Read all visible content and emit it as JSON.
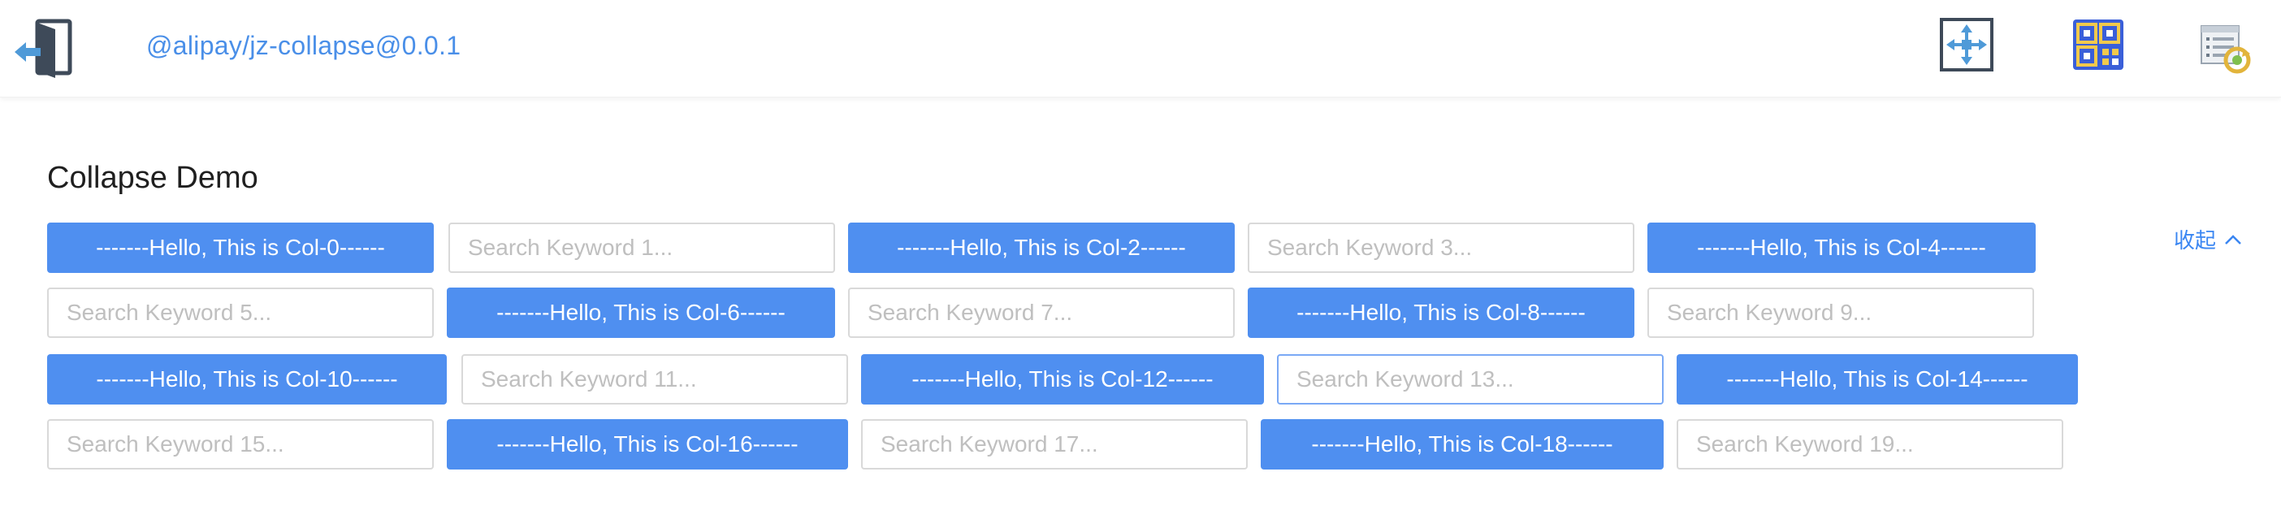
{
  "header": {
    "package_name": "@alipay/jz-collapse@0.0.1",
    "icons": [
      "door-exit-icon",
      "fullscreen-arrows-icon",
      "qrcode-icon",
      "report-refresh-icon"
    ]
  },
  "page": {
    "title": "Collapse Demo",
    "collapse_label": "收起"
  },
  "colors": {
    "accent": "#4f8ff0",
    "link": "#3a86f2",
    "input_border": "#d9d9d9",
    "placeholder": "#bfbfbf"
  },
  "grid": {
    "rows": [
      [
        {
          "type": "button",
          "label": "-------Hello, This is Col-0------"
        },
        {
          "type": "input",
          "placeholder": "Search Keyword 1..."
        },
        {
          "type": "button",
          "label": "-------Hello, This is Col-2------"
        },
        {
          "type": "input",
          "placeholder": "Search Keyword 3..."
        },
        {
          "type": "button",
          "label": "-------Hello, This is Col-4------"
        }
      ],
      [
        {
          "type": "input",
          "placeholder": "Search Keyword 5..."
        },
        {
          "type": "button",
          "label": "-------Hello, This is Col-6------"
        },
        {
          "type": "input",
          "placeholder": "Search Keyword 7..."
        },
        {
          "type": "button",
          "label": "-------Hello, This is Col-8------"
        },
        {
          "type": "input",
          "placeholder": "Search Keyword 9..."
        }
      ],
      [
        {
          "type": "button",
          "label": "-------Hello, This is Col-10------"
        },
        {
          "type": "input",
          "placeholder": "Search Keyword 11..."
        },
        {
          "type": "button",
          "label": "-------Hello, This is Col-12------"
        },
        {
          "type": "input",
          "placeholder": "Search Keyword 13...",
          "focused": true
        },
        {
          "type": "button",
          "label": "-------Hello, This is Col-14------"
        }
      ],
      [
        {
          "type": "input",
          "placeholder": "Search Keyword 15..."
        },
        {
          "type": "button",
          "label": "-------Hello, This is Col-16------"
        },
        {
          "type": "input",
          "placeholder": "Search Keyword 17..."
        },
        {
          "type": "button",
          "label": "-------Hello, This is Col-18------"
        },
        {
          "type": "input",
          "placeholder": "Search Keyword 19..."
        }
      ]
    ]
  }
}
